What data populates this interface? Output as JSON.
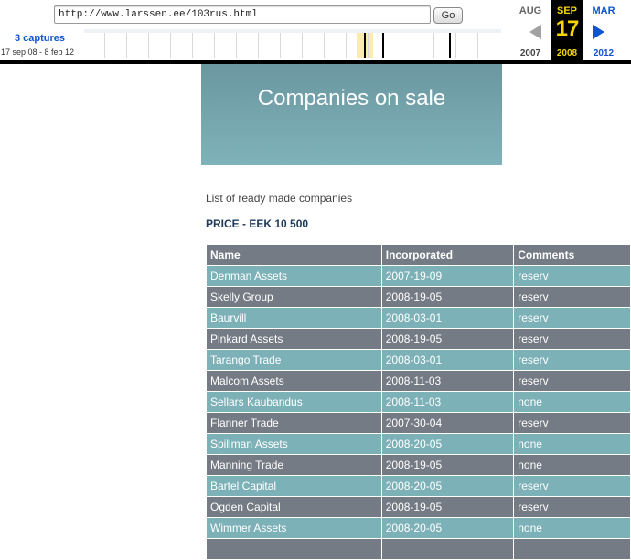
{
  "wayback": {
    "url": "http://www.larssen.ee/103rus.html",
    "go_label": "Go",
    "captures_label": "3 captures",
    "captures_range": "17 sep 08 - 8 feb 12",
    "calendar": {
      "prev_month": "AUG",
      "prev_year": "2007",
      "current_month": "SEP",
      "current_day": "17",
      "current_year": "2008",
      "next_month": "MAR",
      "next_year": "2012"
    },
    "colors": {
      "highlight": "#f7d500",
      "link": "#1155cc"
    }
  },
  "page": {
    "title": "Companies on sale",
    "intro": "List of ready made companies",
    "price": "PRICE - EEK 10 500",
    "table": {
      "headers": [
        "Name",
        "Incorporated",
        "Comments"
      ],
      "rows": [
        [
          "Denman Assets",
          "2007-19-09",
          "reserv"
        ],
        [
          "Skelly Group",
          "2008-19-05",
          "reserv"
        ],
        [
          "Baurvill",
          "2008-03-01",
          "reserv"
        ],
        [
          "Pinkard Assets",
          "2008-19-05",
          "reserv"
        ],
        [
          "Tarango Trade",
          "2008-03-01",
          "reserv"
        ],
        [
          "Malcom Assets",
          "2008-11-03",
          "reserv"
        ],
        [
          "Sellars Kaubandus",
          "2008-11-03",
          "none"
        ],
        [
          "Flanner Trade",
          "2007-30-04",
          "reserv"
        ],
        [
          "Spillman Assets",
          "2008-20-05",
          "none"
        ],
        [
          "Manning Trade",
          "2008-19-05",
          "none"
        ],
        [
          "Bartel Capital",
          "2008-20-05",
          "reserv"
        ],
        [
          "Ogden Capital",
          "2008-19-05",
          "reserv"
        ],
        [
          "Wimmer Assets",
          "2008-20-05",
          "none"
        ],
        [
          "",
          "",
          ""
        ]
      ]
    },
    "colors": {
      "row_light": "#7db1b8",
      "row_dark": "#747b84",
      "banner": "#7fb2ba"
    }
  }
}
